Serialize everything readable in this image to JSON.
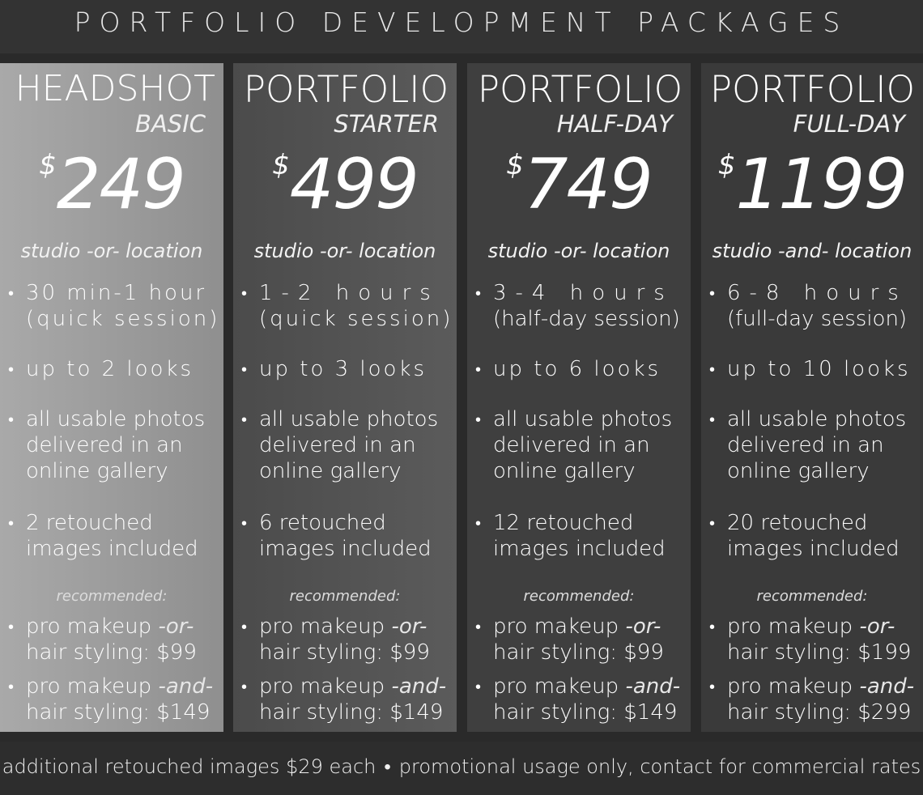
{
  "header": {
    "title": "PORTFOLIO DEVELOPMENT PACKAGES"
  },
  "packages": [
    {
      "name": "HEADSHOT",
      "sub": "BASIC",
      "currency": "$",
      "price": "249",
      "location": "studio -or- location",
      "duration_1": "30 min-1 hour",
      "duration_2": "(quick session)",
      "looks": "up to 2 looks",
      "gallery_1": "all usable photos",
      "gallery_2": "delivered in an",
      "gallery_3": "online gallery",
      "retouch_1": "2 retouched",
      "retouch_2": "images included",
      "recommended": "recommended:",
      "makeup_or_a": "pro makeup",
      "makeup_or_b": "-or-",
      "makeup_or_c": "hair styling:  $99",
      "makeup_and_a": "pro makeup",
      "makeup_and_b": "-and-",
      "makeup_and_c": "hair styling:  $149"
    },
    {
      "name": "PORTFOLIO",
      "sub": "STARTER",
      "currency": "$",
      "price": "499",
      "location": "studio -or- location",
      "duration_1": "1-2 hours",
      "duration_2": "(quick session)",
      "looks": "up to 3 looks",
      "gallery_1": "all usable photos",
      "gallery_2": "delivered in an",
      "gallery_3": "online gallery",
      "retouch_1": "6 retouched",
      "retouch_2": "images included",
      "recommended": "recommended:",
      "makeup_or_a": "pro makeup",
      "makeup_or_b": "-or-",
      "makeup_or_c": "hair styling:  $99",
      "makeup_and_a": "pro makeup",
      "makeup_and_b": "-and-",
      "makeup_and_c": "hair styling:  $149"
    },
    {
      "name": "PORTFOLIO",
      "sub": "HALF-DAY",
      "currency": "$",
      "price": "749",
      "location": "studio -or- location",
      "duration_1": "3-4 hours",
      "duration_2": "(half-day session)",
      "looks": "up to 6 looks",
      "gallery_1": "all usable photos",
      "gallery_2": "delivered in an",
      "gallery_3": "online gallery",
      "retouch_1": "12 retouched",
      "retouch_2": "images included",
      "recommended": "recommended:",
      "makeup_or_a": "pro makeup",
      "makeup_or_b": "-or-",
      "makeup_or_c": "hair styling:  $99",
      "makeup_and_a": "pro makeup",
      "makeup_and_b": "-and-",
      "makeup_and_c": "hair styling:  $149"
    },
    {
      "name": "PORTFOLIO",
      "sub": "FULL-DAY",
      "currency": "$",
      "price": "1199",
      "location": "studio -and- location",
      "duration_1": "6-8 hours",
      "duration_2": "(full-day session)",
      "looks": "up to 10 looks",
      "gallery_1": "all usable photos",
      "gallery_2": "delivered in an",
      "gallery_3": "online gallery",
      "retouch_1": "20 retouched",
      "retouch_2": "images included",
      "recommended": "recommended:",
      "makeup_or_a": "pro makeup",
      "makeup_or_b": "-or-",
      "makeup_or_c": "hair styling:  $199",
      "makeup_and_a": "pro makeup",
      "makeup_and_b": "-and-",
      "makeup_and_c": "hair styling:  $299"
    }
  ],
  "footer": {
    "left": "additional retouched images $29 each",
    "bullet": "•",
    "right": "promotional usage only, contact for commercial rates"
  },
  "bullet": "•"
}
